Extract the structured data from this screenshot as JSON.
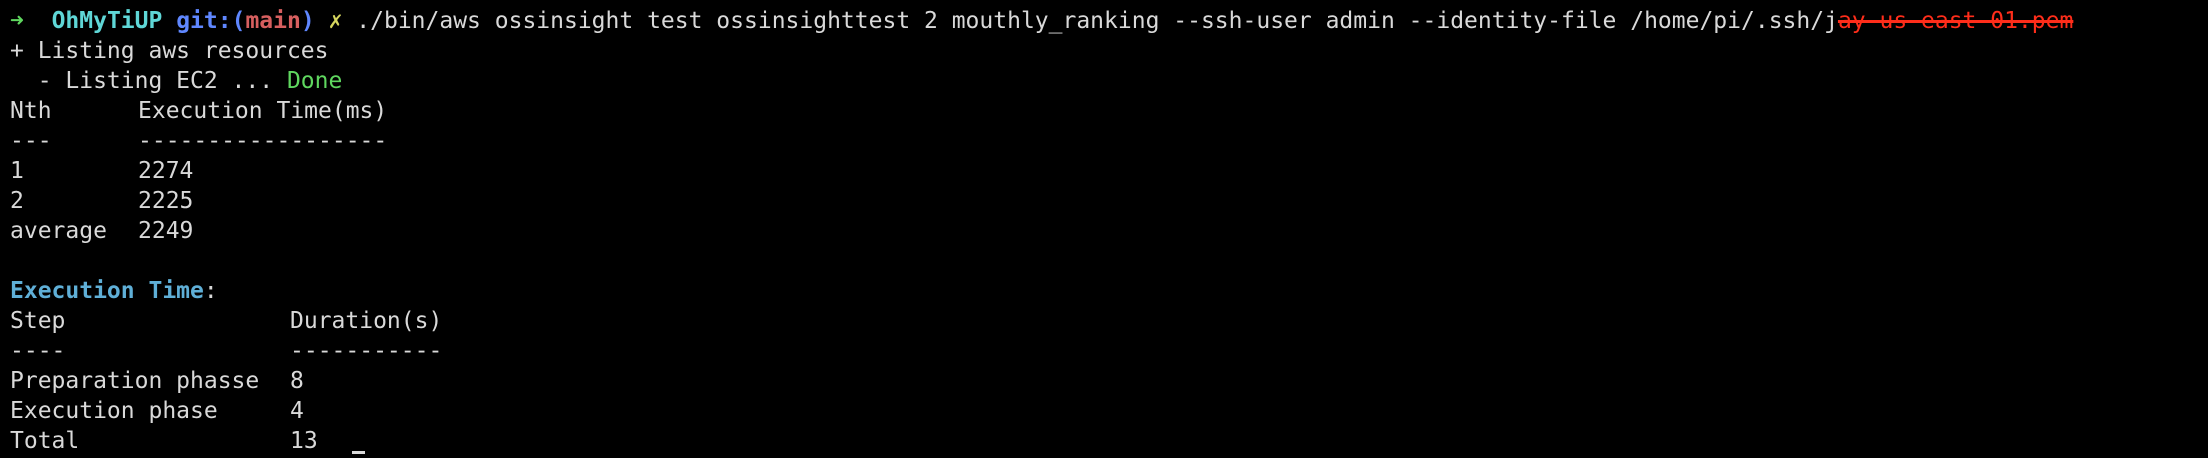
{
  "prompt": {
    "arrow": "➜",
    "host": "OhMyTiUP",
    "git_label": "git:(",
    "branch": "main",
    "git_close": ")",
    "dirty": "✗",
    "command": "./bin/aws ossinsight test ossinsighttest 2 mouthly_ranking --ssh-user admin --identity-file /home/pi/.ssh/j",
    "redacted_tail": "ay-us-east-01.pem"
  },
  "listing": {
    "line1": "+ Listing aws resources",
    "line2_prefix": "  - Listing EC2 ... ",
    "line2_status": "Done"
  },
  "table1": {
    "headers": [
      "Nth",
      "Execution Time(ms)"
    ],
    "separators": [
      "---",
      "------------------"
    ],
    "rows": [
      [
        "1",
        "2274"
      ],
      [
        "2",
        "2225"
      ],
      [
        "average",
        "2249"
      ]
    ]
  },
  "section": {
    "title": "Execution Time",
    "colon": ":"
  },
  "table2": {
    "headers": [
      "Step",
      "Duration(s)"
    ],
    "separators": [
      "----",
      "-----------"
    ],
    "rows": [
      [
        "Preparation phasse",
        "8"
      ],
      [
        "Execution phase",
        "4"
      ],
      [
        "Total",
        "13"
      ]
    ]
  },
  "colors": {
    "background": "#000000",
    "text": "#d9d9d9",
    "prompt_arrow": "#5fd75f",
    "host": "#5fd7d7",
    "git": "#5f87ff",
    "branch": "#d75f5f",
    "dirty": "#d7d75f",
    "done": "#5fd75f",
    "heading": "#5fafd7",
    "redaction": "#ff2d1a"
  }
}
